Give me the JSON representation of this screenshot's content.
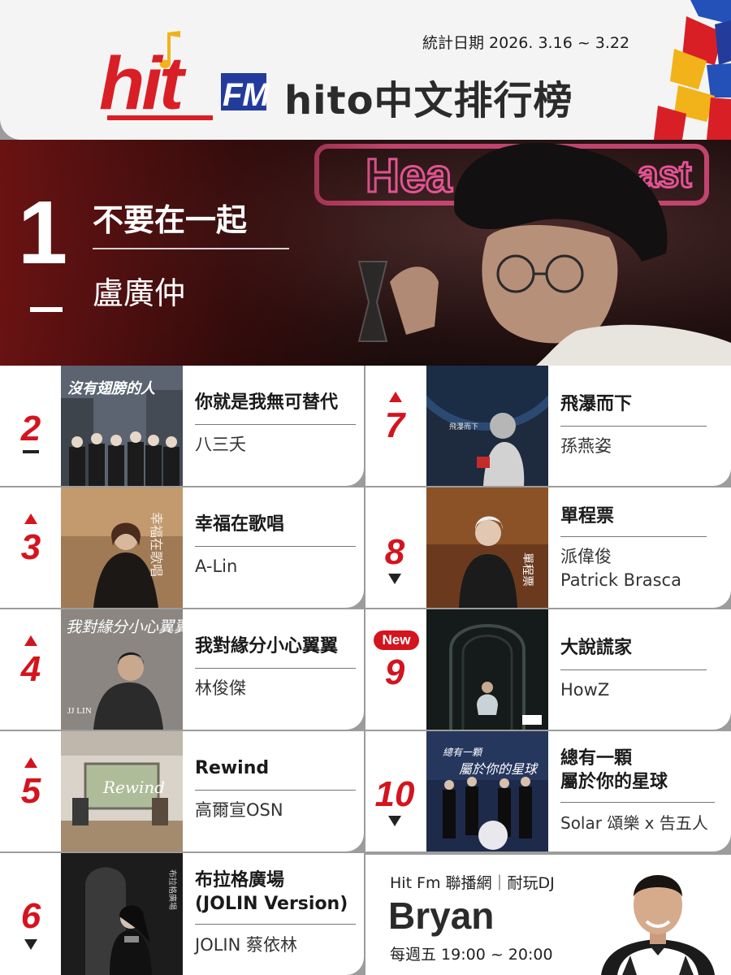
{
  "header": {
    "date": "統計日期 2026. 3.16 ~ 3.22",
    "title": "hito中文排行榜",
    "logo_text": "hit FM"
  },
  "colors": {
    "accent": "#d4141e",
    "up": "#d4141e",
    "down": "#222222"
  },
  "hero": {
    "rank": "1",
    "song": "不要在一起",
    "artist": "盧廣仲",
    "status": "same",
    "neon_sign": "Heartbreak"
  },
  "entries": [
    {
      "rank": "2",
      "song": "你就是我無可替代",
      "artist": "八三夭",
      "status": "same",
      "cover_text": "沒有翅膀的人"
    },
    {
      "rank": "3",
      "song": "幸福在歌唱",
      "artist": "A-Lin",
      "status": "up"
    },
    {
      "rank": "4",
      "song": "我對緣分小心翼翼",
      "artist": "林俊傑",
      "status": "up",
      "cover_text": "JJ LIN"
    },
    {
      "rank": "5",
      "song": "Rewind",
      "artist": "高爾宣OSN",
      "status": "up",
      "cover_text": "Rewind"
    },
    {
      "rank": "6",
      "song_line1": "布拉格廣場",
      "song_line2": "(JOLIN Version)",
      "artist": "JOLIN 蔡依林",
      "status": "down"
    },
    {
      "rank": "7",
      "song": "飛瀑而下",
      "artist": "孫燕姿",
      "status": "up"
    },
    {
      "rank": "8",
      "song": "單程票",
      "artist_line1": "派偉俊",
      "artist_line2": "Patrick Brasca",
      "status": "down",
      "cover_text": "單程票"
    },
    {
      "rank": "9",
      "song": "大說謊家",
      "artist": "HowZ",
      "status": "new",
      "badge": "New"
    },
    {
      "rank": "10",
      "song_line1": "總有一顆",
      "song_line2": "屬於你的星球",
      "artist": "Solar 頌樂 x 告五人",
      "status": "down",
      "cover_text": "總有一顆屬於你的星球"
    }
  ],
  "dj": {
    "network": "Hit Fm 聯播網｜耐玩DJ",
    "name": "Bryan",
    "schedule": "每週五 19:00 ~ 20:00"
  }
}
